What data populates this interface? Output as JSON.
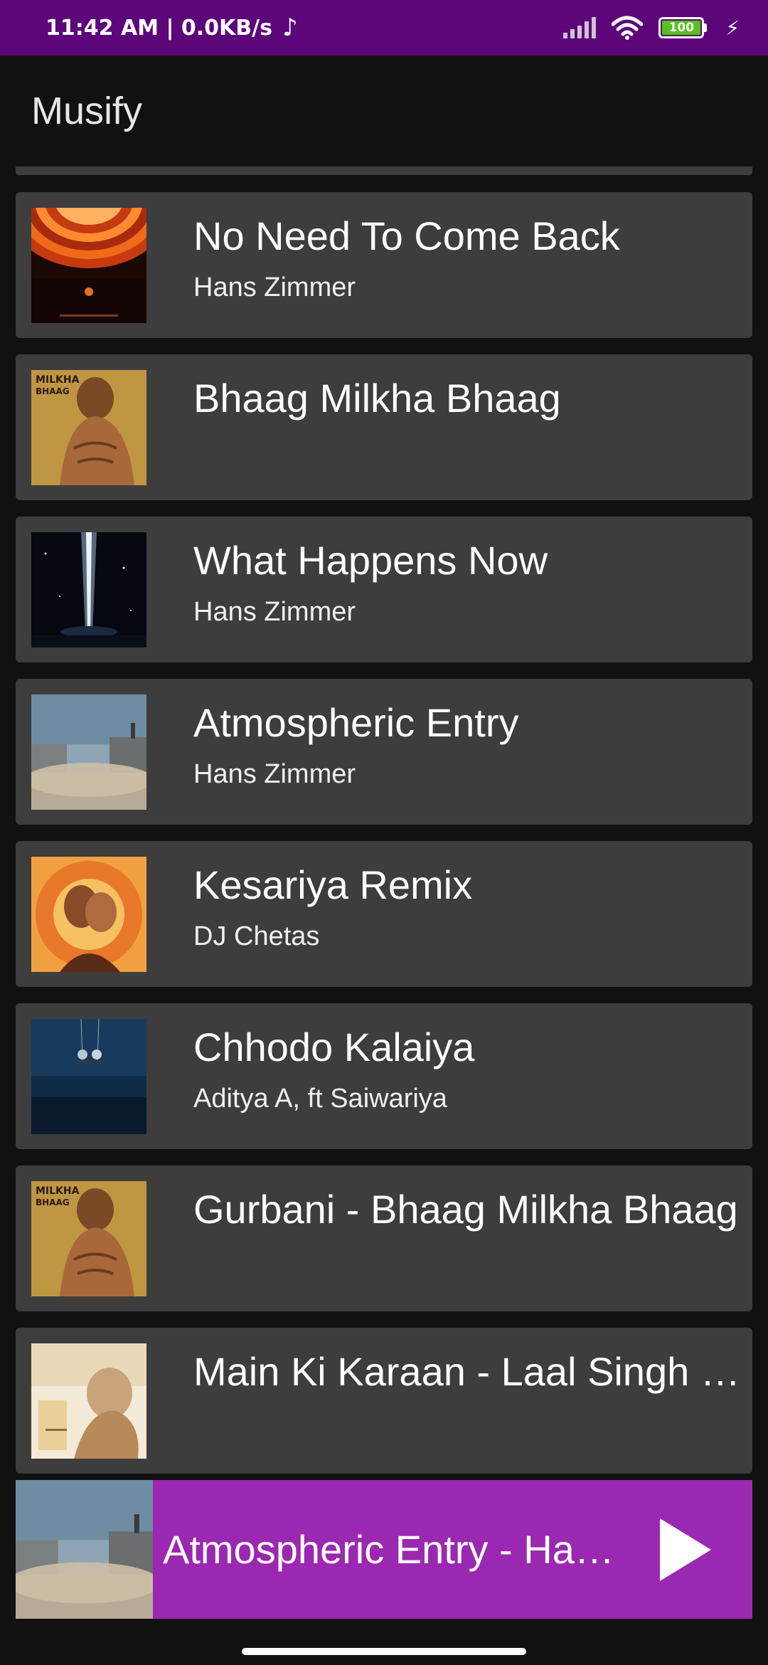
{
  "status_bar": {
    "time": "11:42 AM | 0.0KB/s",
    "music_note": "♪",
    "battery": "100",
    "icons": [
      "signal-icon",
      "wifi-icon",
      "battery-icon",
      "charging-icon"
    ]
  },
  "app_bar": {
    "title": "Musify"
  },
  "songs": [
    {
      "title": "No Need To Come Back",
      "artist": "Hans Zimmer",
      "art": "orange-rings-art"
    },
    {
      "title": "Bhaag Milkha Bhaag",
      "artist": "",
      "art": "milkha-poster-art"
    },
    {
      "title": "What Happens Now",
      "artist": "Hans Zimmer",
      "art": "space-launch-art"
    },
    {
      "title": "Atmospheric Entry",
      "artist": "Hans Zimmer",
      "art": "dusty-farm-art"
    },
    {
      "title": "Kesariya Remix",
      "artist": "DJ Chetas",
      "art": "fiery-couple-art"
    },
    {
      "title": "Chhodo Kalaiya",
      "artist": "Aditya A, ft Saiwariya",
      "art": "night-swing-art"
    },
    {
      "title": "Gurbani - Bhaag Milkha Bhaag",
      "artist": "",
      "art": "milkha-poster-art"
    },
    {
      "title": "Main Ki Karaan - Laal Singh Chaddha",
      "artist": "",
      "art": "laal-singh-art"
    }
  ],
  "mini_player": {
    "title": "Atmospheric Entry - Hans Zimmer",
    "play_icon": "play-icon"
  },
  "colors": {
    "status_bar": "#5c067a",
    "background": "#111111",
    "card": "#3d3d3d",
    "mini_player": "#9b28b0"
  }
}
